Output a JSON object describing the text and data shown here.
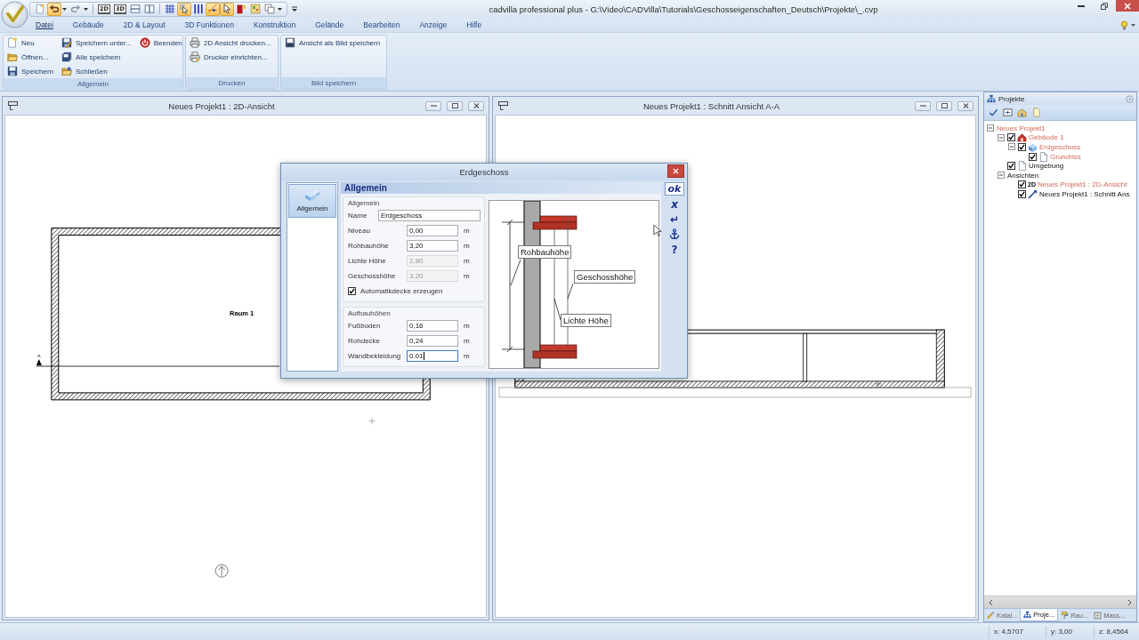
{
  "app": {
    "title": "cadvilla professional plus - G:\\Video\\CADVilla\\Tutorials\\Geschosseigenschaften_Deutsch\\Projekte\\_.cvp"
  },
  "quick_access": [
    {
      "selected": false
    },
    {
      "selected": true
    },
    {
      "selected": false
    },
    {
      "label": "2D",
      "selected": false
    },
    {
      "label": "3D",
      "selected": false
    },
    {
      "selected": false
    },
    {
      "selected": false
    },
    {
      "selected": false
    },
    {
      "selected": true
    },
    {
      "selected": false
    },
    {
      "selected": true
    },
    {
      "selected": true
    },
    {
      "selected": false
    },
    {
      "selected": false
    },
    {
      "selected": false
    }
  ],
  "menu": [
    {
      "label": "Datei",
      "selected": true
    },
    {
      "label": "Gebäude",
      "selected": false
    },
    {
      "label": "2D & Layout",
      "selected": false
    },
    {
      "label": "3D Funktionen",
      "selected": false
    },
    {
      "label": "Konstruktion",
      "selected": false
    },
    {
      "label": "Gelände",
      "selected": false
    },
    {
      "label": "Bearbeiten",
      "selected": false
    },
    {
      "label": "Anzeige",
      "selected": false
    },
    {
      "label": "Hilfe",
      "selected": false
    }
  ],
  "ribbon": {
    "groups": [
      {
        "label": "Allgemein",
        "columns": [
          [
            "Neu",
            "Öffnen...",
            "Speichern"
          ],
          [
            "Speichern unter...",
            "Alle speichern",
            "Schließen"
          ],
          [
            "Beenden"
          ]
        ]
      },
      {
        "label": "Drucken",
        "columns": [
          [
            "2D Ansicht drucken...",
            "Drucker einrichten..."
          ]
        ]
      },
      {
        "label": "Bild speichern",
        "columns": [
          [
            "Ansicht als Bild speichern"
          ]
        ]
      }
    ]
  },
  "windows": [
    {
      "kind": "plan",
      "title": "Neues Projekt1 : 2D-Ansicht",
      "room_label": "Raum 1"
    },
    {
      "kind": "section",
      "title": "Neues Projekt1 : Schnitt Ansicht A-A"
    }
  ],
  "dialog": {
    "title": "Erdgeschoss",
    "nav": [
      {
        "label": "Allgemein",
        "selected": true
      }
    ],
    "header": "Allgemein",
    "groups": [
      {
        "legend": "Allgemein",
        "fields": [
          {
            "kind": "text",
            "label": "Name",
            "value": "Erdgeschoss",
            "disabled": false,
            "focused": false
          },
          {
            "kind": "number",
            "label": "Niveau",
            "value": "0,00",
            "unit": "m",
            "disabled": false,
            "focused": false
          },
          {
            "kind": "number",
            "label": "Rohbauhöhe",
            "value": "3,20",
            "unit": "m",
            "disabled": false,
            "focused": false
          },
          {
            "kind": "number",
            "label": "Lichte Höhe",
            "value": "2,80",
            "unit": "m",
            "disabled": true,
            "focused": false
          },
          {
            "kind": "number",
            "label": "Geschosshöhe",
            "value": "3,20",
            "unit": "m",
            "disabled": true,
            "focused": false
          },
          {
            "kind": "checkbox",
            "label": "Automatikdecke erzeugen",
            "checked": true
          }
        ]
      },
      {
        "legend": "Aufbauhöhen",
        "fields": [
          {
            "kind": "number",
            "label": "Fußboden",
            "value": "0,16",
            "unit": "m",
            "disabled": false,
            "focused": false
          },
          {
            "kind": "number",
            "label": "Rohdecke",
            "value": "0,24",
            "unit": "m",
            "disabled": false,
            "focused": false
          },
          {
            "kind": "number",
            "label": "Wandbekleidung",
            "value": "0.01",
            "unit": "m",
            "disabled": false,
            "focused": true
          }
        ]
      }
    ],
    "figure_labels": [
      "Rohbauhöhe",
      "Geschosshöhe",
      "Lichte Höhe"
    ],
    "side_buttons": [
      {
        "kind": "ok",
        "label": "ok"
      },
      {
        "kind": "cancel",
        "label": "x"
      },
      {
        "kind": "apply",
        "label": "↵"
      },
      {
        "kind": "anchor"
      },
      {
        "kind": "help",
        "label": "?"
      }
    ]
  },
  "projects_panel": {
    "title": "Projekte",
    "tree": [
      {
        "label": "Neues Projekt1",
        "highlighted": true,
        "expanded": true,
        "children": [
          {
            "kind": "building",
            "label": "Gebäude 1",
            "checked": true,
            "highlighted": true,
            "expanded": true,
            "children": [
              {
                "kind": "storey",
                "label": "Erdgeschoss",
                "checked": true,
                "highlighted": true,
                "expanded": true,
                "children": [
                  {
                    "kind": "plan",
                    "label": "Grundriss",
                    "checked": true,
                    "highlighted": true
                  }
                ]
              }
            ]
          },
          {
            "kind": "site",
            "label": "Umgebung",
            "checked": true,
            "highlighted": false
          },
          {
            "label": "Ansichten",
            "highlighted": false,
            "expanded": true,
            "children": [
              {
                "kind": "view2d",
                "badge": "2D",
                "label": "Neues Projekt1 : 2D-Ansicht",
                "checked": true,
                "highlighted": true
              },
              {
                "kind": "section",
                "label": "Neues Projekt1 : Schnitt Ans",
                "checked": true,
                "highlighted": false
              }
            ]
          }
        ]
      }
    ],
    "tabs": [
      {
        "label": "Katal...",
        "selected": false
      },
      {
        "label": "Proje...",
        "selected": true
      },
      {
        "label": "Rau...",
        "selected": false
      },
      {
        "label": "Mass...",
        "selected": false
      }
    ]
  },
  "status_bar": [
    "x: 4,5707",
    "y: 3,00",
    "z: 8,4564"
  ]
}
